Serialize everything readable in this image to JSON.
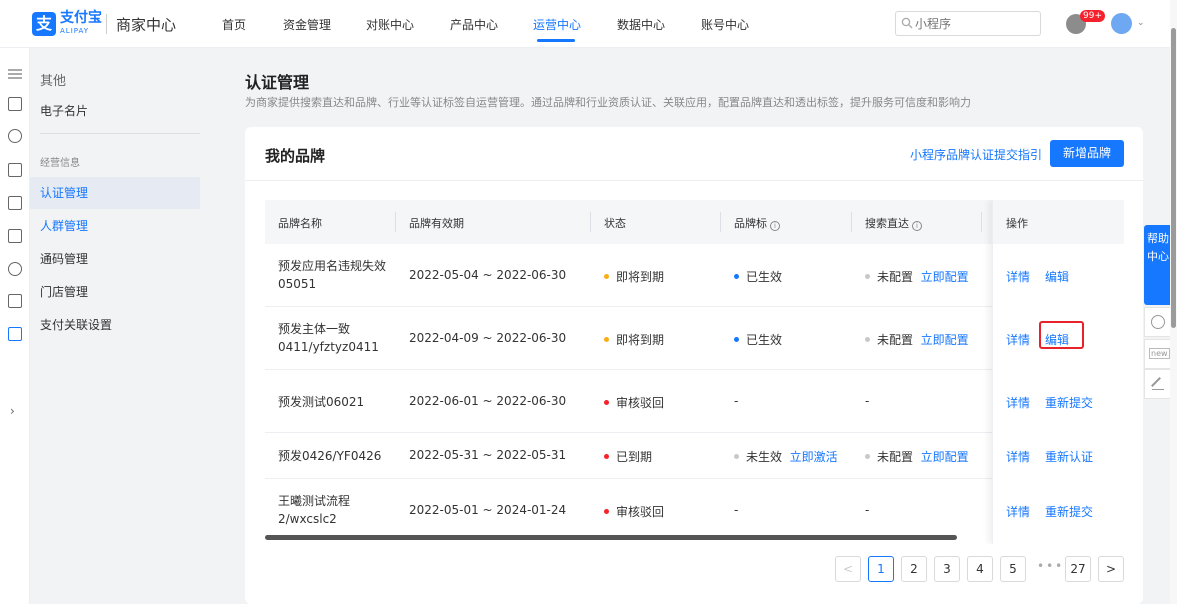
{
  "header": {
    "logo_mark": "支",
    "logo_text": "支付宝",
    "logo_sub": "ALIPAY",
    "app_name": "商家中心",
    "nav": [
      "首页",
      "资金管理",
      "对账中心",
      "产品中心",
      "运营中心",
      "数据中心",
      "账号中心"
    ],
    "active_nav": "运营中心",
    "search_placeholder": "小程序",
    "notification_badge": "99+"
  },
  "sidebar": {
    "section_title": "其他",
    "items_top": [
      "电子名片"
    ],
    "group_label": "经营信息",
    "items": [
      "认证管理",
      "人群管理",
      "通码管理",
      "门店管理",
      "支付关联设置"
    ],
    "active_item": "认证管理"
  },
  "page": {
    "title": "认证管理",
    "description": "为商家提供搜索直达和品牌、行业等认证标签自运营管理。通过品牌和行业资质认证、关联应用，配置品牌直达和透出标签，提升服务可信度和影响力"
  },
  "card": {
    "title": "我的品牌",
    "guide_link": "小程序品牌认证提交指引",
    "new_button": "新增品牌"
  },
  "table": {
    "columns": [
      "品牌名称",
      "品牌有效期",
      "状态",
      "品牌标",
      "搜索直达",
      "操作"
    ],
    "rows": [
      {
        "name_line1": "预发应用名违规失效",
        "name_line2": "05051",
        "validity": "2022-05-04 ~ 2022-06-30",
        "status": "即将到期",
        "status_color": "#faad14",
        "brand_mark": "已生效",
        "brand_mark_color": "#1677ff",
        "brand_mark_link": "",
        "search": "未配置",
        "search_link": "立即配置",
        "op1": "详情",
        "op2": "编辑"
      },
      {
        "name_line1": "预发主体一致",
        "name_line2": "0411/yfztyz0411",
        "validity": "2022-04-09 ~ 2022-06-30",
        "status": "即将到期",
        "status_color": "#faad14",
        "brand_mark": "已生效",
        "brand_mark_color": "#1677ff",
        "brand_mark_link": "",
        "search": "未配置",
        "search_link": "立即配置",
        "op1": "详情",
        "op2": "编辑"
      },
      {
        "name_line1": "预发测试06021",
        "name_line2": "",
        "validity": "2022-06-01 ~ 2022-06-30",
        "status": "审核驳回",
        "status_color": "#f5222d",
        "brand_mark": "-",
        "brand_mark_color": "",
        "brand_mark_link": "",
        "search": "-",
        "search_link": "",
        "op1": "详情",
        "op2": "重新提交"
      },
      {
        "name_line1": "预发0426/YF0426",
        "name_line2": "",
        "validity": "2022-05-31 ~ 2022-05-31",
        "status": "已到期",
        "status_color": "#f5222d",
        "brand_mark": "未生效",
        "brand_mark_color": "#c8c8c8",
        "brand_mark_link": "立即激活",
        "search": "未配置",
        "search_link": "立即配置",
        "op1": "详情",
        "op2": "重新认证"
      },
      {
        "name_line1": "王曦测试流程",
        "name_line2": "2/wxcslc2",
        "validity": "2022-05-01 ~ 2024-01-24",
        "status": "审核驳回",
        "status_color": "#f5222d",
        "brand_mark": "-",
        "brand_mark_color": "",
        "brand_mark_link": "",
        "search": "-",
        "search_link": "",
        "op1": "详情",
        "op2": "重新提交"
      }
    ]
  },
  "pagination": {
    "pages": [
      "1",
      "2",
      "3",
      "4",
      "5"
    ],
    "ellipsis": "•••",
    "last": "27",
    "current": "1",
    "prev": "<",
    "next": ">"
  },
  "help": {
    "tab_label": "帮助中心",
    "new_label": "new"
  }
}
